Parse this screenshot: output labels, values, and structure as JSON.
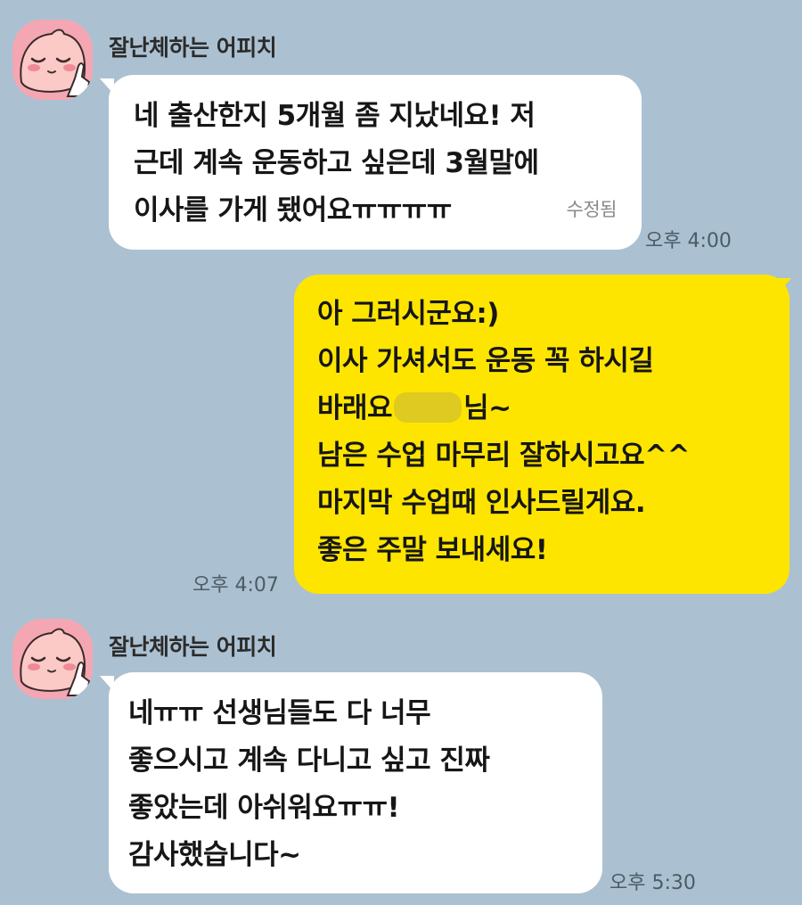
{
  "messages": [
    {
      "sender": "잘난체하는 어피치",
      "lines": [
        "네 출산한지 5개월 좀 지났네요! 저",
        "근데 계속 운동하고 싶은데 3월말에",
        "이사를 가게 됐어요ㅠㅠㅠㅠ"
      ],
      "edited": "수정됨",
      "time": "오후 4:00"
    },
    {
      "lines": [
        "아 그러시군요:)",
        "이사 가셔서도 운동 꼭 하시길",
        "바래요",
        "님~",
        "남은 수업 마무리 잘하시고요^^",
        "마지막 수업때 인사드릴게요.",
        "좋은 주말 보내세요!"
      ],
      "time": "오후 4:07"
    },
    {
      "sender": "잘난체하는 어피치",
      "lines": [
        "네ㅠㅠ 선생님들도 다 너무",
        "좋으시고  계속 다니고 싶고 진짜",
        "좋았는데 아쉬워요ㅠㅠ!",
        "감사했습니다~"
      ],
      "time": "오후 5:30"
    }
  ],
  "colors": {
    "background": "#abc1d1",
    "incoming_bubble": "#ffffff",
    "outgoing_bubble": "#fee500",
    "avatar_bg": "#f4a7b3"
  },
  "icons": {
    "avatar": "apeach-avatar-icon"
  }
}
